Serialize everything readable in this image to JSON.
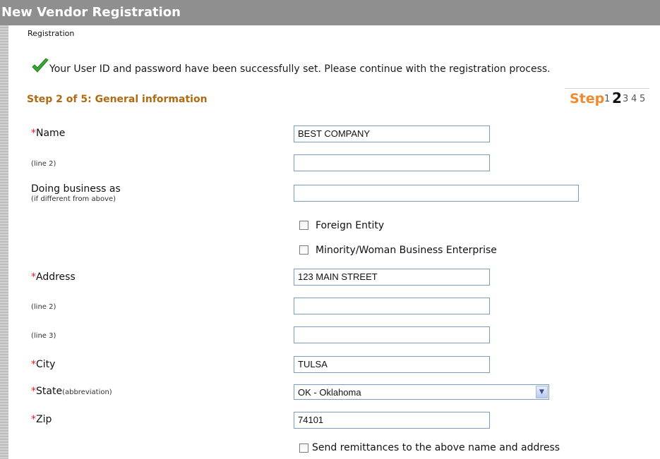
{
  "window": {
    "title": "New Vendor Registration"
  },
  "breadcrumb": "Registration",
  "success_message": "Your User ID and password have been successfully set. Please continue with the registration process.",
  "step": {
    "title": "Step 2 of 5: General information",
    "nav_label": "Step",
    "numbers": [
      "1",
      "2",
      "3",
      "4",
      "5"
    ],
    "current": "2"
  },
  "form": {
    "required_mark": "*",
    "name": {
      "label": "Name",
      "value": "BEST COMPANY"
    },
    "name_line2": {
      "label": "(line 2)",
      "value": ""
    },
    "dba": {
      "label": "Doing business as",
      "sublabel": "(if different from above)",
      "value": ""
    },
    "foreign_entity": {
      "label": "Foreign Entity",
      "checked": false
    },
    "minority": {
      "label": "Minority/Woman Business Enterprise",
      "checked": false
    },
    "address": {
      "label": "Address",
      "value": "123 MAIN STREET"
    },
    "address_line2": {
      "label": "(line 2)",
      "value": ""
    },
    "address_line3": {
      "label": "(line 3)",
      "value": ""
    },
    "city": {
      "label": "City",
      "value": "TULSA"
    },
    "state": {
      "label": "State",
      "sublabel": "(abbreviation)",
      "value": "OK - Oklahoma"
    },
    "zip": {
      "label": "Zip",
      "value": "74101"
    },
    "remittance": {
      "label": "Send remittances to the above name and address",
      "checked": false
    }
  },
  "colors": {
    "title_bar": "#8f8f8f",
    "step_title": "#b06a10",
    "step_accent": "#f08a2e",
    "required": "#e02020"
  }
}
